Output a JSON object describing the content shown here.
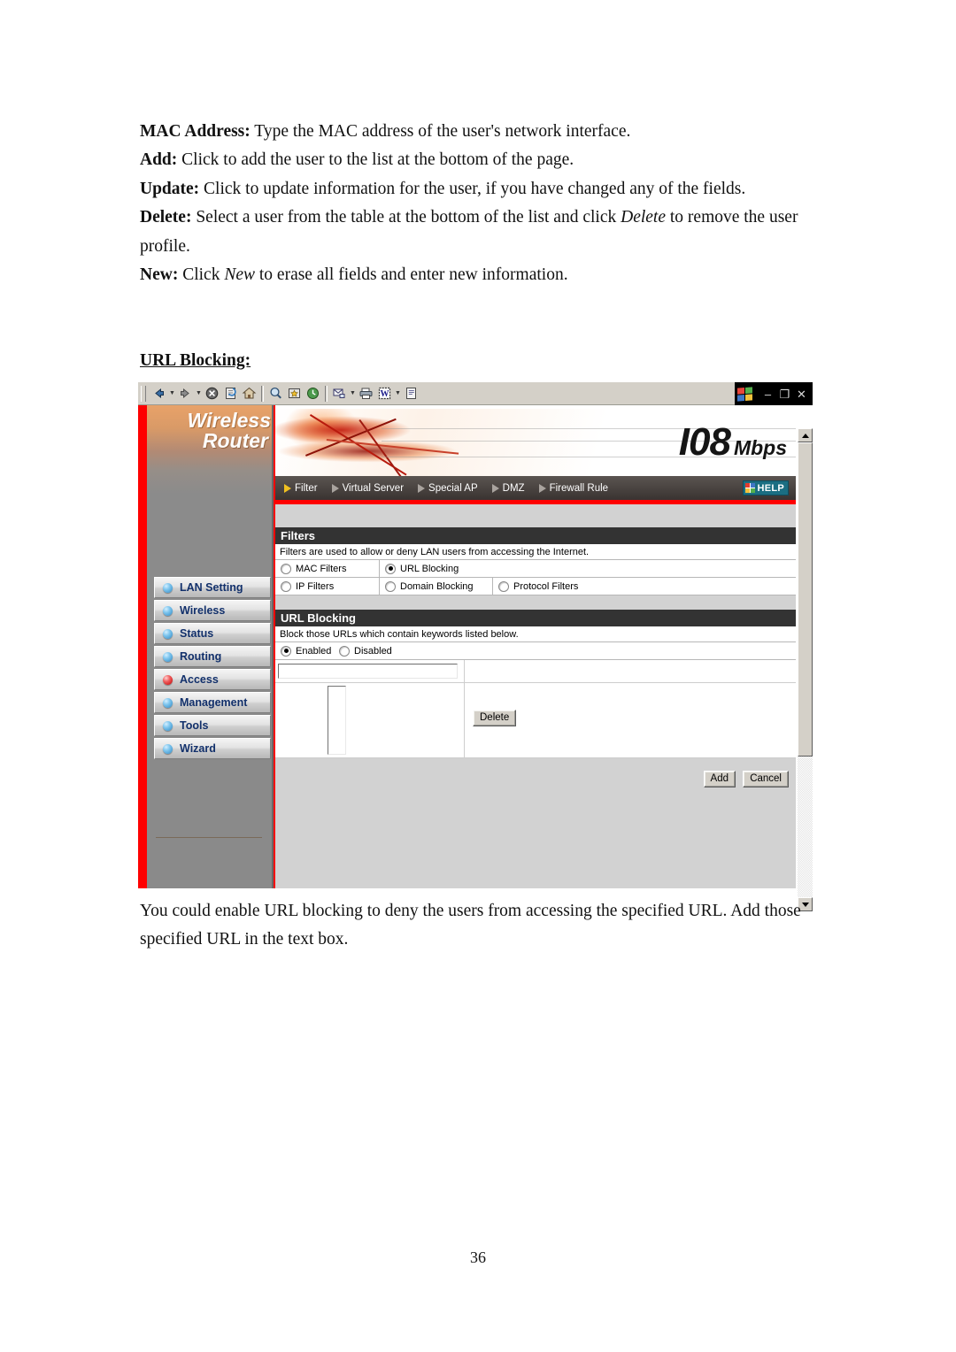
{
  "document": {
    "intro_lines": [
      {
        "label": "MAC Address:",
        "text": " Type the MAC address of the user's network interface."
      },
      {
        "label": "Add:",
        "text": " Click to add the user to the list at the bottom of the page."
      },
      {
        "label": "Update:",
        "text": " Click to update information for the user, if you have changed any of the fields."
      },
      {
        "label": "Delete:",
        "text": " Select a user from the table at the bottom of the list and click ",
        "italic": "Delete",
        "text2": " to remove the user profile."
      },
      {
        "label": "New:",
        "text": " Click ",
        "italic": "New",
        "text2": " to erase all fields and enter new information."
      }
    ],
    "section_heading": "URL Blocking:",
    "outro_text": "You could enable URL blocking to deny the users from accessing the specified URL. Add those specified URL in the text box.",
    "page_number": "36"
  },
  "browser": {
    "toolbar_buttons": [
      "back-icon",
      "forward-icon",
      "stop-icon",
      "refresh-icon",
      "home-icon",
      "search-icon",
      "favorites-icon",
      "history-icon",
      "mail-icon",
      "print-icon",
      "edit-word-icon",
      "discuss-icon"
    ],
    "window_controls": {
      "app_icon": "windows-logo-icon",
      "minimize": "–",
      "restore": "❐",
      "close": "✕"
    }
  },
  "router": {
    "logo": {
      "line1": "Wireless",
      "line2": "Router"
    },
    "banner": {
      "speed": "I08",
      "unit": "Mbps"
    },
    "nav_tabs": [
      {
        "label": "Filter",
        "active": true
      },
      {
        "label": "Virtual Server",
        "active": false
      },
      {
        "label": "Special AP",
        "active": false
      },
      {
        "label": "DMZ",
        "active": false
      },
      {
        "label": "Firewall Rule",
        "active": false
      }
    ],
    "help_button": "HELP",
    "sidebar_items": [
      {
        "label": "LAN Setting",
        "active": false
      },
      {
        "label": "Wireless",
        "active": false
      },
      {
        "label": "Status",
        "active": false
      },
      {
        "label": "Routing",
        "active": false
      },
      {
        "label": "Access",
        "active": true
      },
      {
        "label": "Management",
        "active": false
      },
      {
        "label": "Tools",
        "active": false
      },
      {
        "label": "Wizard",
        "active": false
      }
    ],
    "filters_panel": {
      "title": "Filters",
      "description": "Filters are used to allow or deny LAN users from accessing the Internet.",
      "options_row1": [
        {
          "label": "MAC Filters",
          "selected": false
        },
        {
          "label": "URL Blocking",
          "selected": true
        }
      ],
      "options_row2": [
        {
          "label": "IP Filters",
          "selected": false
        },
        {
          "label": "Domain Blocking",
          "selected": false
        },
        {
          "label": "Protocol Filters",
          "selected": false
        }
      ]
    },
    "url_blocking_panel": {
      "title": "URL Blocking",
      "description": "Block those URLs which contain keywords listed below.",
      "state_options": [
        {
          "label": "Enabled",
          "selected": true
        },
        {
          "label": "Disabled",
          "selected": false
        }
      ],
      "keyword_input_value": "",
      "keyword_list": [],
      "delete_button": "Delete",
      "add_button": "Add",
      "cancel_button": "Cancel"
    }
  },
  "colors": {
    "frame_red": "#fe0000",
    "panel_header": "#333333",
    "content_bg": "#d2d2d2",
    "menu_text": "#12306b",
    "help_bg": "#1b6e82",
    "active_tab_arrow": "#f0c020"
  }
}
